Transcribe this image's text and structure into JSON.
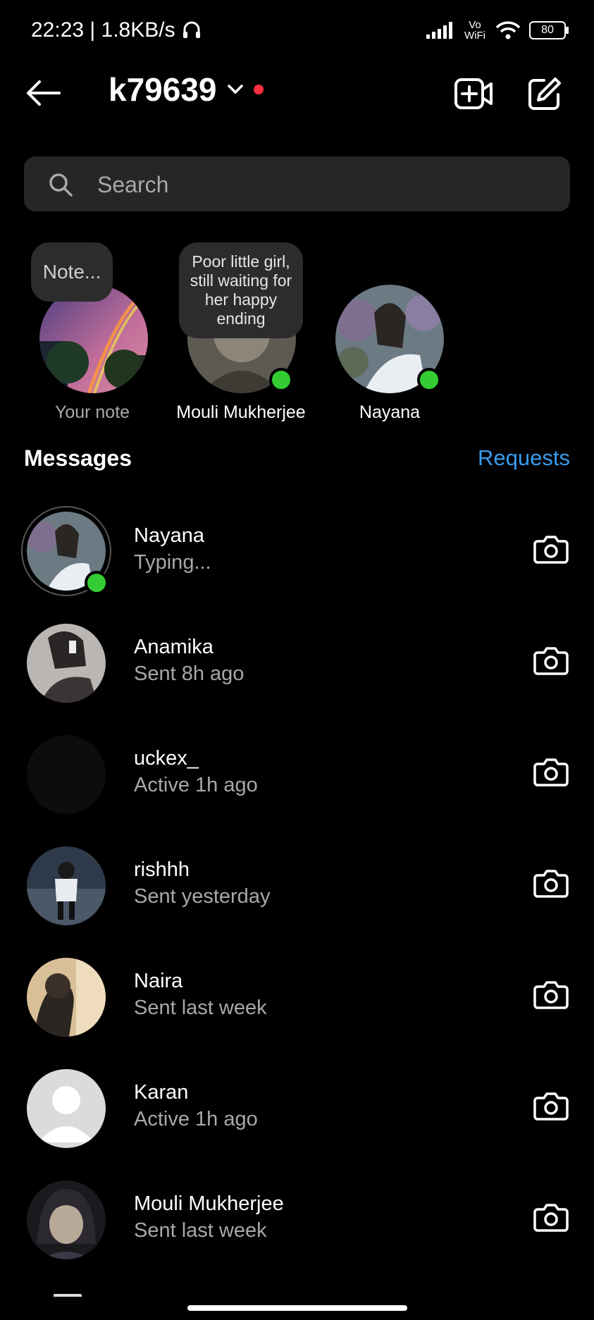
{
  "status_bar": {
    "time_speed": "22:23 | 1.8KB/s",
    "network": "Vo WiFi",
    "battery": "80",
    "icons": [
      "headphones-icon",
      "signal-icon",
      "wifi-icon",
      "battery-icon"
    ]
  },
  "header": {
    "username": "k79639",
    "icons": [
      "back-arrow-icon",
      "chevron-down-icon",
      "video-call-icon",
      "compose-icon"
    ],
    "accent_dot_color": "#ff3040"
  },
  "search": {
    "placeholder": "Search"
  },
  "notes": [
    {
      "bubble": "Note...",
      "label": "Your note"
    },
    {
      "bubble": "Poor little girl, still waiting for her happy ending",
      "label": "Mouli Mukherjee",
      "online": true
    },
    {
      "label": "Nayana",
      "online": true
    }
  ],
  "messages": {
    "heading": "Messages",
    "requests": "Requests",
    "rows": [
      {
        "name": "Nayana",
        "sub": "Typing...",
        "online": true
      },
      {
        "name": "Anamika",
        "sub": "Sent 8h ago"
      },
      {
        "name": "uckex_",
        "sub": "Active 1h ago"
      },
      {
        "name": "rishhh",
        "sub": "Sent yesterday"
      },
      {
        "name": "Naira",
        "sub": "Sent last week"
      },
      {
        "name": "Karan",
        "sub": "Active 1h ago"
      },
      {
        "name": "Mouli Mukherjee",
        "sub": "Sent last week"
      }
    ]
  },
  "colors": {
    "background": "#000000",
    "link": "#3a9cf0",
    "online": "#33cc33",
    "muted": "#a8a8a8"
  }
}
